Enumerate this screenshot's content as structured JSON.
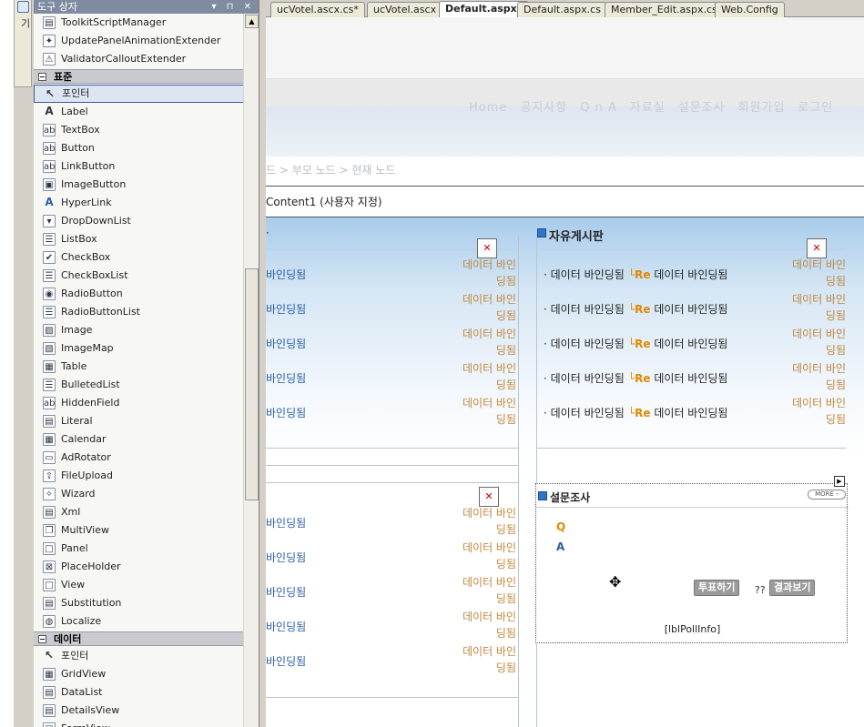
{
  "sidebar_tab": {
    "label": "솔루션 탐색기"
  },
  "toolbox": {
    "title": "도구 상자",
    "header_controls": "▾ ⊓ ✕",
    "items_top": [
      {
        "label": "ToolkitScriptManager",
        "icon": "script-manager-icon",
        "glyph": "▤"
      },
      {
        "label": "UpdatePanelAnimationExtender",
        "icon": "animation-extender-icon",
        "glyph": "✦"
      },
      {
        "label": "ValidatorCalloutExtender",
        "icon": "warning-callout-icon",
        "glyph": "⚠"
      }
    ],
    "group_standard": "표준",
    "items_standard": [
      {
        "label": "포인터",
        "icon": "pointer-icon",
        "glyph": "↖"
      },
      {
        "label": "Label",
        "icon": "label-icon",
        "glyph": "A"
      },
      {
        "label": "TextBox",
        "icon": "textbox-icon",
        "glyph": "ab"
      },
      {
        "label": "Button",
        "icon": "button-icon",
        "glyph": "ab"
      },
      {
        "label": "LinkButton",
        "icon": "linkbutton-icon",
        "glyph": "ab"
      },
      {
        "label": "ImageButton",
        "icon": "imagebutton-icon",
        "glyph": "▣"
      },
      {
        "label": "HyperLink",
        "icon": "hyperlink-icon",
        "glyph": "A"
      },
      {
        "label": "DropDownList",
        "icon": "dropdownlist-icon",
        "glyph": "▾"
      },
      {
        "label": "ListBox",
        "icon": "listbox-icon",
        "glyph": "☰"
      },
      {
        "label": "CheckBox",
        "icon": "checkbox-icon",
        "glyph": "✔"
      },
      {
        "label": "CheckBoxList",
        "icon": "checkboxlist-icon",
        "glyph": "☰"
      },
      {
        "label": "RadioButton",
        "icon": "radiobutton-icon",
        "glyph": "◉"
      },
      {
        "label": "RadioButtonList",
        "icon": "radiobuttonlist-icon",
        "glyph": "☰"
      },
      {
        "label": "Image",
        "icon": "image-icon",
        "glyph": "▨"
      },
      {
        "label": "ImageMap",
        "icon": "imagemap-icon",
        "glyph": "▧"
      },
      {
        "label": "Table",
        "icon": "table-icon",
        "glyph": "▦"
      },
      {
        "label": "BulletedList",
        "icon": "bulletedlist-icon",
        "glyph": "☰"
      },
      {
        "label": "HiddenField",
        "icon": "hiddenfield-icon",
        "glyph": "ab"
      },
      {
        "label": "Literal",
        "icon": "literal-icon",
        "glyph": "▤"
      },
      {
        "label": "Calendar",
        "icon": "calendar-icon",
        "glyph": "▦"
      },
      {
        "label": "AdRotator",
        "icon": "adrotator-icon",
        "glyph": "▭"
      },
      {
        "label": "FileUpload",
        "icon": "fileupload-icon",
        "glyph": "⇪"
      },
      {
        "label": "Wizard",
        "icon": "wizard-icon",
        "glyph": "✧"
      },
      {
        "label": "Xml",
        "icon": "xml-icon",
        "glyph": "▤"
      },
      {
        "label": "MultiView",
        "icon": "multiview-icon",
        "glyph": "❐"
      },
      {
        "label": "Panel",
        "icon": "panel-icon",
        "glyph": "□"
      },
      {
        "label": "PlaceHolder",
        "icon": "placeholder-icon",
        "glyph": "⊠"
      },
      {
        "label": "View",
        "icon": "view-icon",
        "glyph": "□"
      },
      {
        "label": "Substitution",
        "icon": "substitution-icon",
        "glyph": "▤"
      },
      {
        "label": "Localize",
        "icon": "localize-icon",
        "glyph": "◍"
      }
    ],
    "group_data": "데이터",
    "items_data": [
      {
        "label": "포인터",
        "icon": "pointer-icon",
        "glyph": "↖"
      },
      {
        "label": "GridView",
        "icon": "gridview-icon",
        "glyph": "▦"
      },
      {
        "label": "DataList",
        "icon": "datalist-icon",
        "glyph": "▤"
      },
      {
        "label": "DetailsView",
        "icon": "detailsview-icon",
        "glyph": "▤"
      },
      {
        "label": "FormView",
        "icon": "formview-icon",
        "glyph": "▤"
      }
    ]
  },
  "tabs": [
    {
      "label": "ucVotel.ascx.cs*",
      "active": false
    },
    {
      "label": "ucVotel.ascx",
      "active": false
    },
    {
      "label": "Default.aspx*",
      "active": true
    },
    {
      "label": "Default.aspx.cs",
      "active": false
    },
    {
      "label": "Member_Edit.aspx.cs",
      "active": false
    },
    {
      "label": "Web.Config",
      "active": false
    }
  ],
  "design": {
    "nav": [
      "Home",
      "공지사항",
      "Q n A",
      "자료실",
      "설문조사",
      "회원가입",
      "로그인"
    ],
    "breadcrumb": "드 > 부모 노드 > 현재 노드",
    "content_header": "Content1 (사용자 지정)",
    "left_panel": {
      "title_fragment": "·",
      "rows": [
        "바인딩됨",
        "바인딩됨",
        "바인딩됨",
        "바인딩됨",
        "바인딩됨"
      ],
      "rows_right": [
        "데이터 바인딩됨",
        "데이터 바인딩됨",
        "데이터 바인딩됨",
        "데이터 바인딩됨",
        "데이터 바인딩됨"
      ],
      "rows2": [
        "바인딩됨",
        "바인딩됨",
        "바인딩됨",
        "바인딩됨",
        "바인딩됨"
      ],
      "rows2_right": [
        "데이터 바인딩됨",
        "데이터 바인딩됨",
        "데이터 바인딩됨",
        "데이터 바인딩됨",
        "데이터 바인딩됨"
      ]
    },
    "free_board": {
      "title": "자유게시판",
      "row_prefix": "데이터 바인딩됨",
      "re": "Re",
      "row_suffix": "데이터 바인딩됨",
      "rows_right": [
        "데이터 바인딩됨",
        "데이터 바인딩됨",
        "데이터 바인딩됨",
        "데이터 바인딩됨",
        "데이터 바인딩됨"
      ]
    },
    "poll": {
      "title": "설문조사",
      "more": "MORE ›",
      "q": "Q",
      "a": "A",
      "vote_button": "투표하기",
      "qq": "??",
      "result_button": "결과보기",
      "info": "[lblPollInfo]"
    }
  }
}
